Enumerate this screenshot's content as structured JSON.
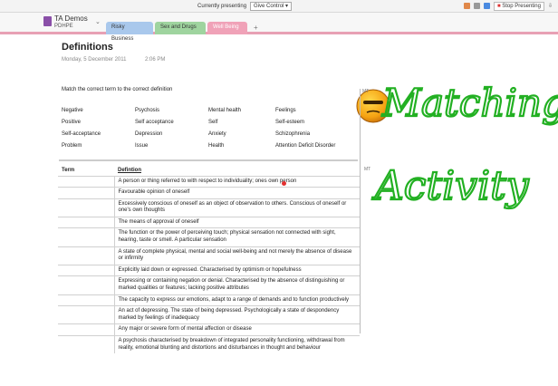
{
  "topbar": {
    "currently_presenting": "Currently presenting",
    "give_control": "Give Control",
    "stop_presenting": "Stop Presenting"
  },
  "notebook": {
    "name": "TA Demos",
    "section_group": "PDHPE",
    "tabs": [
      {
        "label": "Risky Business",
        "color": "#a9c8ec"
      },
      {
        "label": "Sex and Drugs",
        "color": "#9fd49f"
      },
      {
        "label": "Well Being",
        "color": "#f0a2b8"
      }
    ],
    "add_tab": "+"
  },
  "page": {
    "title": "Definitions",
    "date": "Monday, 5 December 2011",
    "time": "2:06 PM",
    "instruction": "Match the correct term to the correct definition",
    "mt_label_1": "MT",
    "mt_label_2": "MT",
    "terms": [
      "Negative",
      "Psychosis",
      "Mental health",
      "Feelings",
      "Positive",
      "Self acceptance",
      "Self",
      "Self-esteem",
      "Self-acceptance",
      "Depression",
      "Anxiety",
      "Schizophrenia",
      "Problem",
      "Issue",
      "Health",
      "Attention Deficit Disorder"
    ],
    "table": {
      "col_term": "Term",
      "col_definition": "Defintion",
      "rows": [
        "A person or thing referred to with respect to individuality; ones own person",
        "Favourable opinion of oneself",
        "Excessively conscious of oneself as an object of observation to others. Conscious of oneself or one's own thoughts",
        "The means of approval of oneself",
        "The function or the power of perceiving touch; physical sensation not connected with sight, hearing, taste or smell. A particular sensation",
        "A state of complete physical, mental and social well-being and not merely the absence of disease or infirmity",
        "Explicitly laid down or expressed. Characterised by optimism or hopefulness",
        "Expressing or containing negation or denial. Characterised by the absence of distinguishing or marked qualities or features; lacking positive attributes",
        "The capacity to express our emotions, adapt to a range of demands and to function productively",
        "An act of depressing. The state of being depressed. Psychologically a state of despondency marked by feelings of inadequacy",
        "Any major or severe form of mental affection or disease",
        "A psychosis characterised by breakdown of integrated personality functioning, withdrawal from reality, emotional blunting and distortions and disturbances in thought and behaviour"
      ]
    }
  },
  "ink": {
    "line1": "Matching",
    "line2": "Activity",
    "color": "#22b022"
  }
}
